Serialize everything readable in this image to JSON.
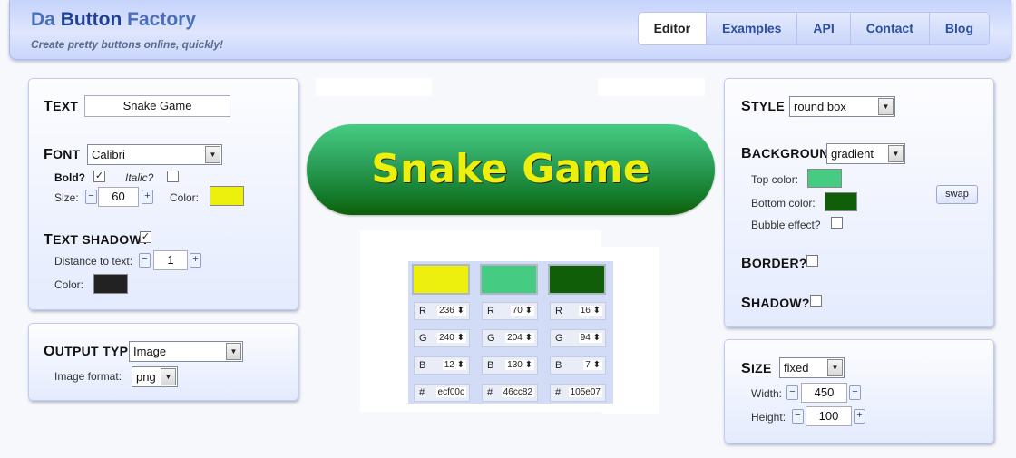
{
  "header": {
    "logo_part1": "Da ",
    "logo_part2": "Button",
    "logo_part3": " Factory",
    "tagline": "Create pretty buttons online, quickly!",
    "nav": [
      "Editor",
      "Examples",
      "API",
      "Contact",
      "Blog"
    ],
    "active_nav": "Editor"
  },
  "text_panel": {
    "text_label_cap": "T",
    "text_label_rest": "EXT",
    "text_value": "Snake Game",
    "font_label_cap": "F",
    "font_label_rest": "ONT",
    "font_value": "Calibri",
    "bold_label": "Bold?",
    "bold_checked": true,
    "italic_label": "Italic?",
    "italic_checked": false,
    "size_label": "Size:",
    "size_value": "60",
    "color_label": "Color:",
    "text_color": "#ecf00c",
    "shadow_label_cap": "T",
    "shadow_label_rest": "EXT SHADOW?",
    "shadow_checked": true,
    "distance_label": "Distance to text:",
    "distance_value": "1",
    "shadow_color_label": "Color:",
    "shadow_color": "#222222"
  },
  "output_panel": {
    "label_cap": "O",
    "label_rest": "UTPUT TYPE",
    "output_value": "Image",
    "format_label": "Image format:",
    "format_value": "png"
  },
  "preview": {
    "button_text": "Snake Game"
  },
  "color_picker": {
    "columns": [
      {
        "color": "#ecf00c",
        "r": "236",
        "g": "240",
        "b": "12",
        "hex": "ecf00c"
      },
      {
        "color": "#46cc82",
        "r": "70",
        "g": "204",
        "b": "130",
        "hex": "46cc82"
      },
      {
        "color": "#105e07",
        "r": "16",
        "g": "94",
        "b": "7",
        "hex": "105e07"
      }
    ],
    "r_label": "R",
    "g_label": "G",
    "b_label": "B",
    "hex_label": "#"
  },
  "style_panel": {
    "style_label_cap": "S",
    "style_label_rest": "TYLE",
    "style_value": "round box",
    "background_label_cap": "B",
    "background_label_rest": "ACKGROUND",
    "background_value": "gradient",
    "top_color_label": "Top color:",
    "top_color": "#46cc82",
    "bottom_color_label": "Bottom color:",
    "bottom_color": "#105e07",
    "bubble_label": "Bubble effect?",
    "bubble_checked": false,
    "swap_label": "swap",
    "border_label_cap": "B",
    "border_label_rest": "ORDER?",
    "border_checked": false,
    "shadow_label_cap": "S",
    "shadow_label_rest": "HADOW?",
    "shadow_checked": false
  },
  "size_panel": {
    "label_cap": "S",
    "label_rest": "IZE",
    "size_mode": "fixed",
    "width_label": "Width:",
    "width_value": "450",
    "height_label": "Height:",
    "height_value": "100"
  }
}
